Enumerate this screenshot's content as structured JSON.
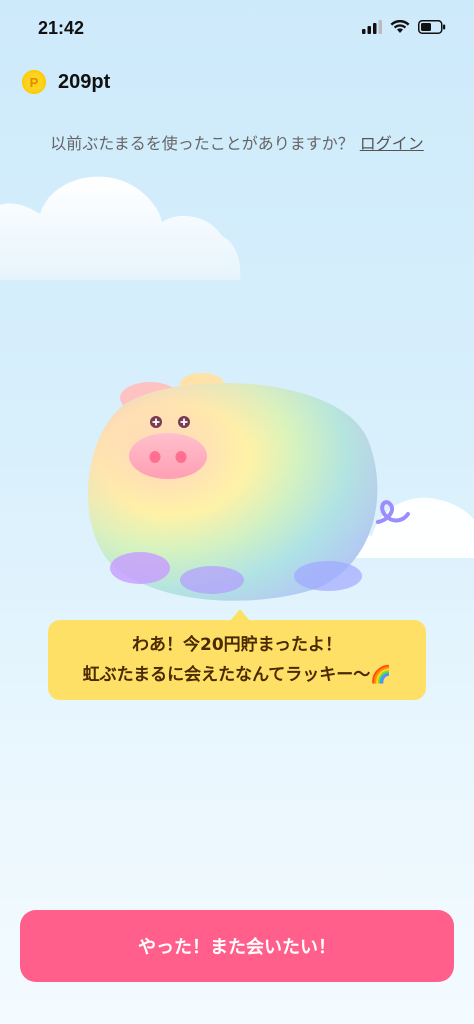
{
  "status": {
    "time": "21:42"
  },
  "points": {
    "coin_label": "P",
    "value": "209pt"
  },
  "login": {
    "question": "以前ぶたまるを使ったことがありますか？",
    "link": "ログイン"
  },
  "bubble": {
    "line1": "わあ！今20円貯まったよ！",
    "line2": "虹ぶたまるに会えたなんてラッキー〜🌈"
  },
  "cta": {
    "label": "やった！また会いたい！"
  },
  "colors": {
    "cta": "#ff5f8a",
    "bubble": "#ffe066",
    "coin": "#ffd21f"
  },
  "icons": [
    "signal-icon",
    "wifi-icon",
    "battery-icon",
    "coin-icon",
    "rainbow-emoji"
  ]
}
